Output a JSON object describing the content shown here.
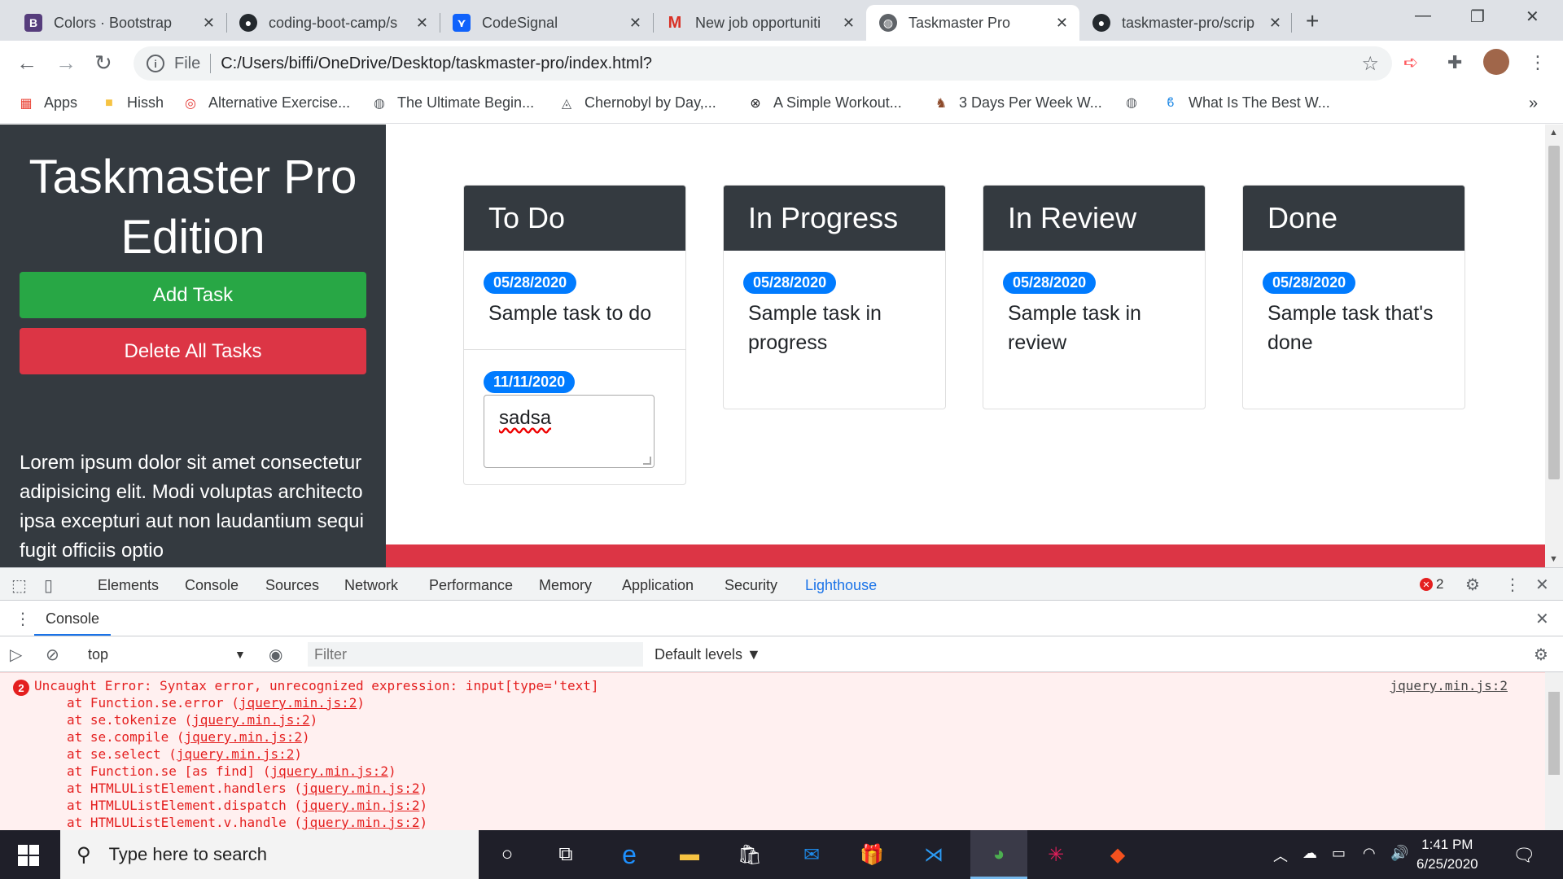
{
  "browser": {
    "tabs": [
      {
        "title": "Colors · Bootstrap",
        "icon": "bootstrap-icon",
        "active": false
      },
      {
        "title": "coding-boot-camp/s",
        "icon": "github-icon",
        "active": false
      },
      {
        "title": "CodeSignal",
        "icon": "codesignal-icon",
        "active": false
      },
      {
        "title": "New job opportuniti",
        "icon": "gmail-icon",
        "active": false
      },
      {
        "title": "Taskmaster Pro",
        "icon": "globe-icon",
        "active": true
      },
      {
        "title": "taskmaster-pro/scrip",
        "icon": "github-icon",
        "active": false
      }
    ],
    "address": {
      "scheme": "File",
      "url": "C:/Users/biffi/OneDrive/Desktop/taskmaster-pro/index.html?"
    },
    "bookmarks": [
      {
        "label": "Apps",
        "icon": "apps-grid-icon"
      },
      {
        "label": "Hissh",
        "icon": "folder-icon"
      },
      {
        "label": "Alternative Exercise...",
        "icon": "target-icon"
      },
      {
        "label": "The Ultimate Begin...",
        "icon": "globe-icon"
      },
      {
        "label": "Chernobyl by Day,...",
        "icon": "site-icon"
      },
      {
        "label": "A Simple Workout...",
        "icon": "x-circle-icon"
      },
      {
        "label": "3 Days Per Week W...",
        "icon": "figure-icon"
      },
      {
        "label": "",
        "icon": "globe-icon"
      },
      {
        "label": "What Is The Best W...",
        "icon": "site-icon"
      }
    ]
  },
  "app": {
    "title": "Taskmaster Pro Edition",
    "add_task": "Add Task",
    "delete_all": "Delete All Tasks",
    "lorem": "Lorem ipsum dolor sit amet consectetur adipisicing elit. Modi voluptas architecto ipsa excepturi aut non laudantium sequi fugit officiis optio",
    "columns": [
      {
        "name": "To Do",
        "items": [
          {
            "date": "05/28/2020",
            "text": "Sample task to do"
          },
          {
            "date": "11/11/2020",
            "editing": "sadsa"
          }
        ]
      },
      {
        "name": "In Progress",
        "items": [
          {
            "date": "05/28/2020",
            "text": "Sample task in progress"
          }
        ]
      },
      {
        "name": "In Review",
        "items": [
          {
            "date": "05/28/2020",
            "text": "Sample task in review"
          }
        ]
      },
      {
        "name": "Done",
        "items": [
          {
            "date": "05/28/2020",
            "text": "Sample task that's done"
          }
        ]
      }
    ]
  },
  "devtools": {
    "tabs": [
      "Elements",
      "Console",
      "Sources",
      "Network",
      "Performance",
      "Memory",
      "Application",
      "Security",
      "Lighthouse"
    ],
    "selected_tab": "Lighthouse",
    "error_count": "2",
    "drawer_tab": "Console",
    "context": "top",
    "filter_placeholder": "Filter",
    "levels": "Default levels ▼",
    "error": {
      "count": "2",
      "message": "Uncaught Error: Syntax error, unrecognized expression: input[type='text]",
      "source": "jquery.min.js:2",
      "frames": [
        {
          "prefix": "at Function.se.error (",
          "link": "jquery.min.js:2",
          "suffix": ")"
        },
        {
          "prefix": "at se.tokenize (",
          "link": "jquery.min.js:2",
          "suffix": ")"
        },
        {
          "prefix": "at se.compile (",
          "link": "jquery.min.js:2",
          "suffix": ")"
        },
        {
          "prefix": "at se.select (",
          "link": "jquery.min.js:2",
          "suffix": ")"
        },
        {
          "prefix": "at Function.se [as find] (",
          "link": "jquery.min.js:2",
          "suffix": ")"
        },
        {
          "prefix": "at HTMLUListElement.handlers (",
          "link": "jquery.min.js:2",
          "suffix": ")"
        },
        {
          "prefix": "at HTMLUListElement.dispatch (",
          "link": "jquery.min.js:2",
          "suffix": ")"
        },
        {
          "prefix": "at HTMLUListElement.v.handle (",
          "link": "jquery.min.js:2",
          "suffix": ")"
        }
      ]
    }
  },
  "taskbar": {
    "search_placeholder": "Type here to search",
    "time": "1:41 PM",
    "date": "6/25/2020"
  }
}
